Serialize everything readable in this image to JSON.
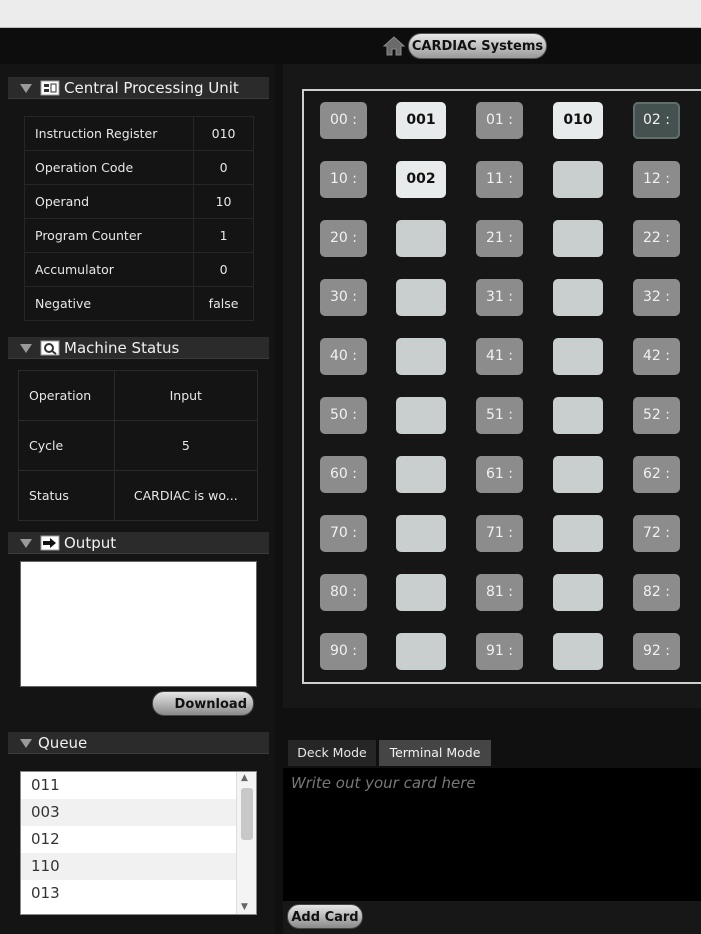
{
  "nav": {
    "brand_label": "CARDIAC Systems"
  },
  "cpu": {
    "title": "Central Processing Unit",
    "rows": [
      {
        "label": "Instruction Register",
        "value": "010"
      },
      {
        "label": "Operation Code",
        "value": "0"
      },
      {
        "label": "Operand",
        "value": "10"
      },
      {
        "label": "Program Counter",
        "value": "1"
      },
      {
        "label": "Accumulator",
        "value": "0"
      },
      {
        "label": "Negative",
        "value": "false"
      }
    ]
  },
  "machine_status": {
    "title": "Machine Status",
    "rows": [
      {
        "label": "Operation",
        "value": "Input"
      },
      {
        "label": "Cycle",
        "value": "5"
      },
      {
        "label": "Status",
        "value": "CARDIAC is wo..."
      }
    ]
  },
  "output": {
    "title": "Output",
    "download_label": "Download"
  },
  "queue": {
    "title": "Queue",
    "items": [
      "011",
      "003",
      "012",
      "110",
      "013"
    ]
  },
  "memory": {
    "rows": [
      {
        "a1": "00 :",
        "v1": "001",
        "a2": "01 :",
        "v2": "010",
        "a3": "02 :"
      },
      {
        "a1": "10 :",
        "v1": "002",
        "a2": "11 :",
        "v2": "",
        "a3": "12 :"
      },
      {
        "a1": "20 :",
        "v1": "",
        "a2": "21 :",
        "v2": "",
        "a3": "22 :"
      },
      {
        "a1": "30 :",
        "v1": "",
        "a2": "31 :",
        "v2": "",
        "a3": "32 :"
      },
      {
        "a1": "40 :",
        "v1": "",
        "a2": "41 :",
        "v2": "",
        "a3": "42 :"
      },
      {
        "a1": "50 :",
        "v1": "",
        "a2": "51 :",
        "v2": "",
        "a3": "52 :"
      },
      {
        "a1": "60 :",
        "v1": "",
        "a2": "61 :",
        "v2": "",
        "a3": "62 :"
      },
      {
        "a1": "70 :",
        "v1": "",
        "a2": "71 :",
        "v2": "",
        "a3": "72 :"
      },
      {
        "a1": "80 :",
        "v1": "",
        "a2": "81 :",
        "v2": "",
        "a3": "82 :"
      },
      {
        "a1": "90 :",
        "v1": "",
        "a2": "91 :",
        "v2": "",
        "a3": "92 :"
      }
    ],
    "active_address": "02 :"
  },
  "modes": {
    "deck_label": "Deck Mode",
    "terminal_label": "Terminal Mode"
  },
  "terminal": {
    "placeholder": "Write out your card here"
  },
  "actions": {
    "add_card_label": "Add Card"
  }
}
